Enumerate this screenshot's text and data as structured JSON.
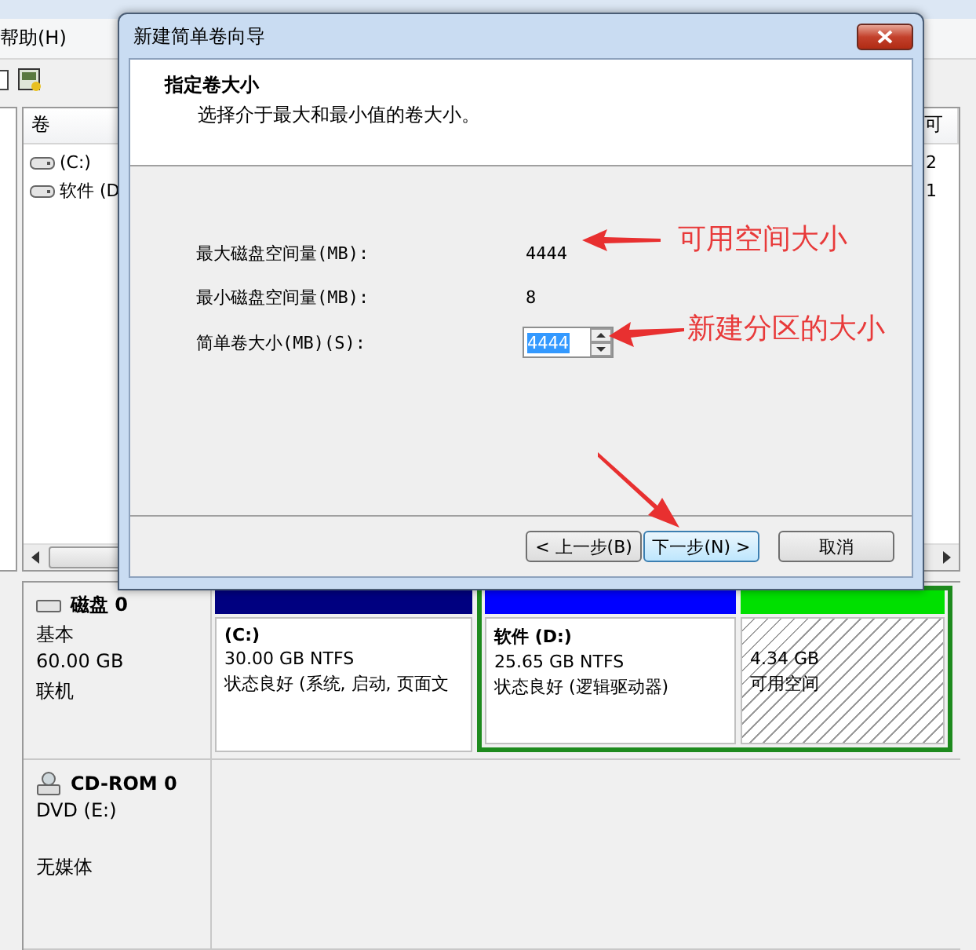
{
  "background_window": {
    "menu": [
      "帮助(H)"
    ],
    "volume_list": {
      "columns": [
        "卷",
        "可"
      ],
      "rows": [
        {
          "volume": "(C:)",
          "column_2": "2"
        },
        {
          "volume": "软件 (D",
          "column_2": "1"
        }
      ]
    },
    "disks": [
      {
        "kind": "disk",
        "name": "磁盘 0",
        "type": "基本",
        "size": "60.00 GB",
        "status": "联机",
        "partitions": [
          {
            "kind": "primary",
            "name": "(C:)",
            "size": "30.00 GB NTFS",
            "status": "状态良好 (系统, 启动, 页面文"
          },
          {
            "kind": "logical",
            "name": "软件 (D:)",
            "size": "25.65 GB NTFS",
            "status": "状态良好 (逻辑驱动器)"
          },
          {
            "kind": "free",
            "size": "4.34 GB",
            "status": "可用空间"
          }
        ]
      },
      {
        "kind": "cdrom",
        "name": "CD-ROM 0",
        "type": "DVD (E:)",
        "status": "无媒体"
      }
    ]
  },
  "dialog": {
    "title": "新建简单卷向导",
    "header_title": "指定卷大小",
    "header_subtitle": "选择介于最大和最小值的卷大小。",
    "fields": [
      {
        "kind": "text",
        "label": "最大磁盘空间量(MB):",
        "value": "4444"
      },
      {
        "kind": "text",
        "label": "最小磁盘空间量(MB):",
        "value": "8"
      },
      {
        "kind": "spinner",
        "label": "简单卷大小(MB)(S):",
        "value": "4444",
        "value_selected": true
      }
    ],
    "buttons": [
      {
        "label": "< 上一步(B)",
        "default": false
      },
      {
        "label": "下一步(N) >",
        "default": true
      },
      {
        "label": "取消",
        "default": false
      }
    ]
  },
  "annotations": [
    {
      "text": "可用空间大小"
    },
    {
      "text": "新建分区的大小"
    }
  ]
}
